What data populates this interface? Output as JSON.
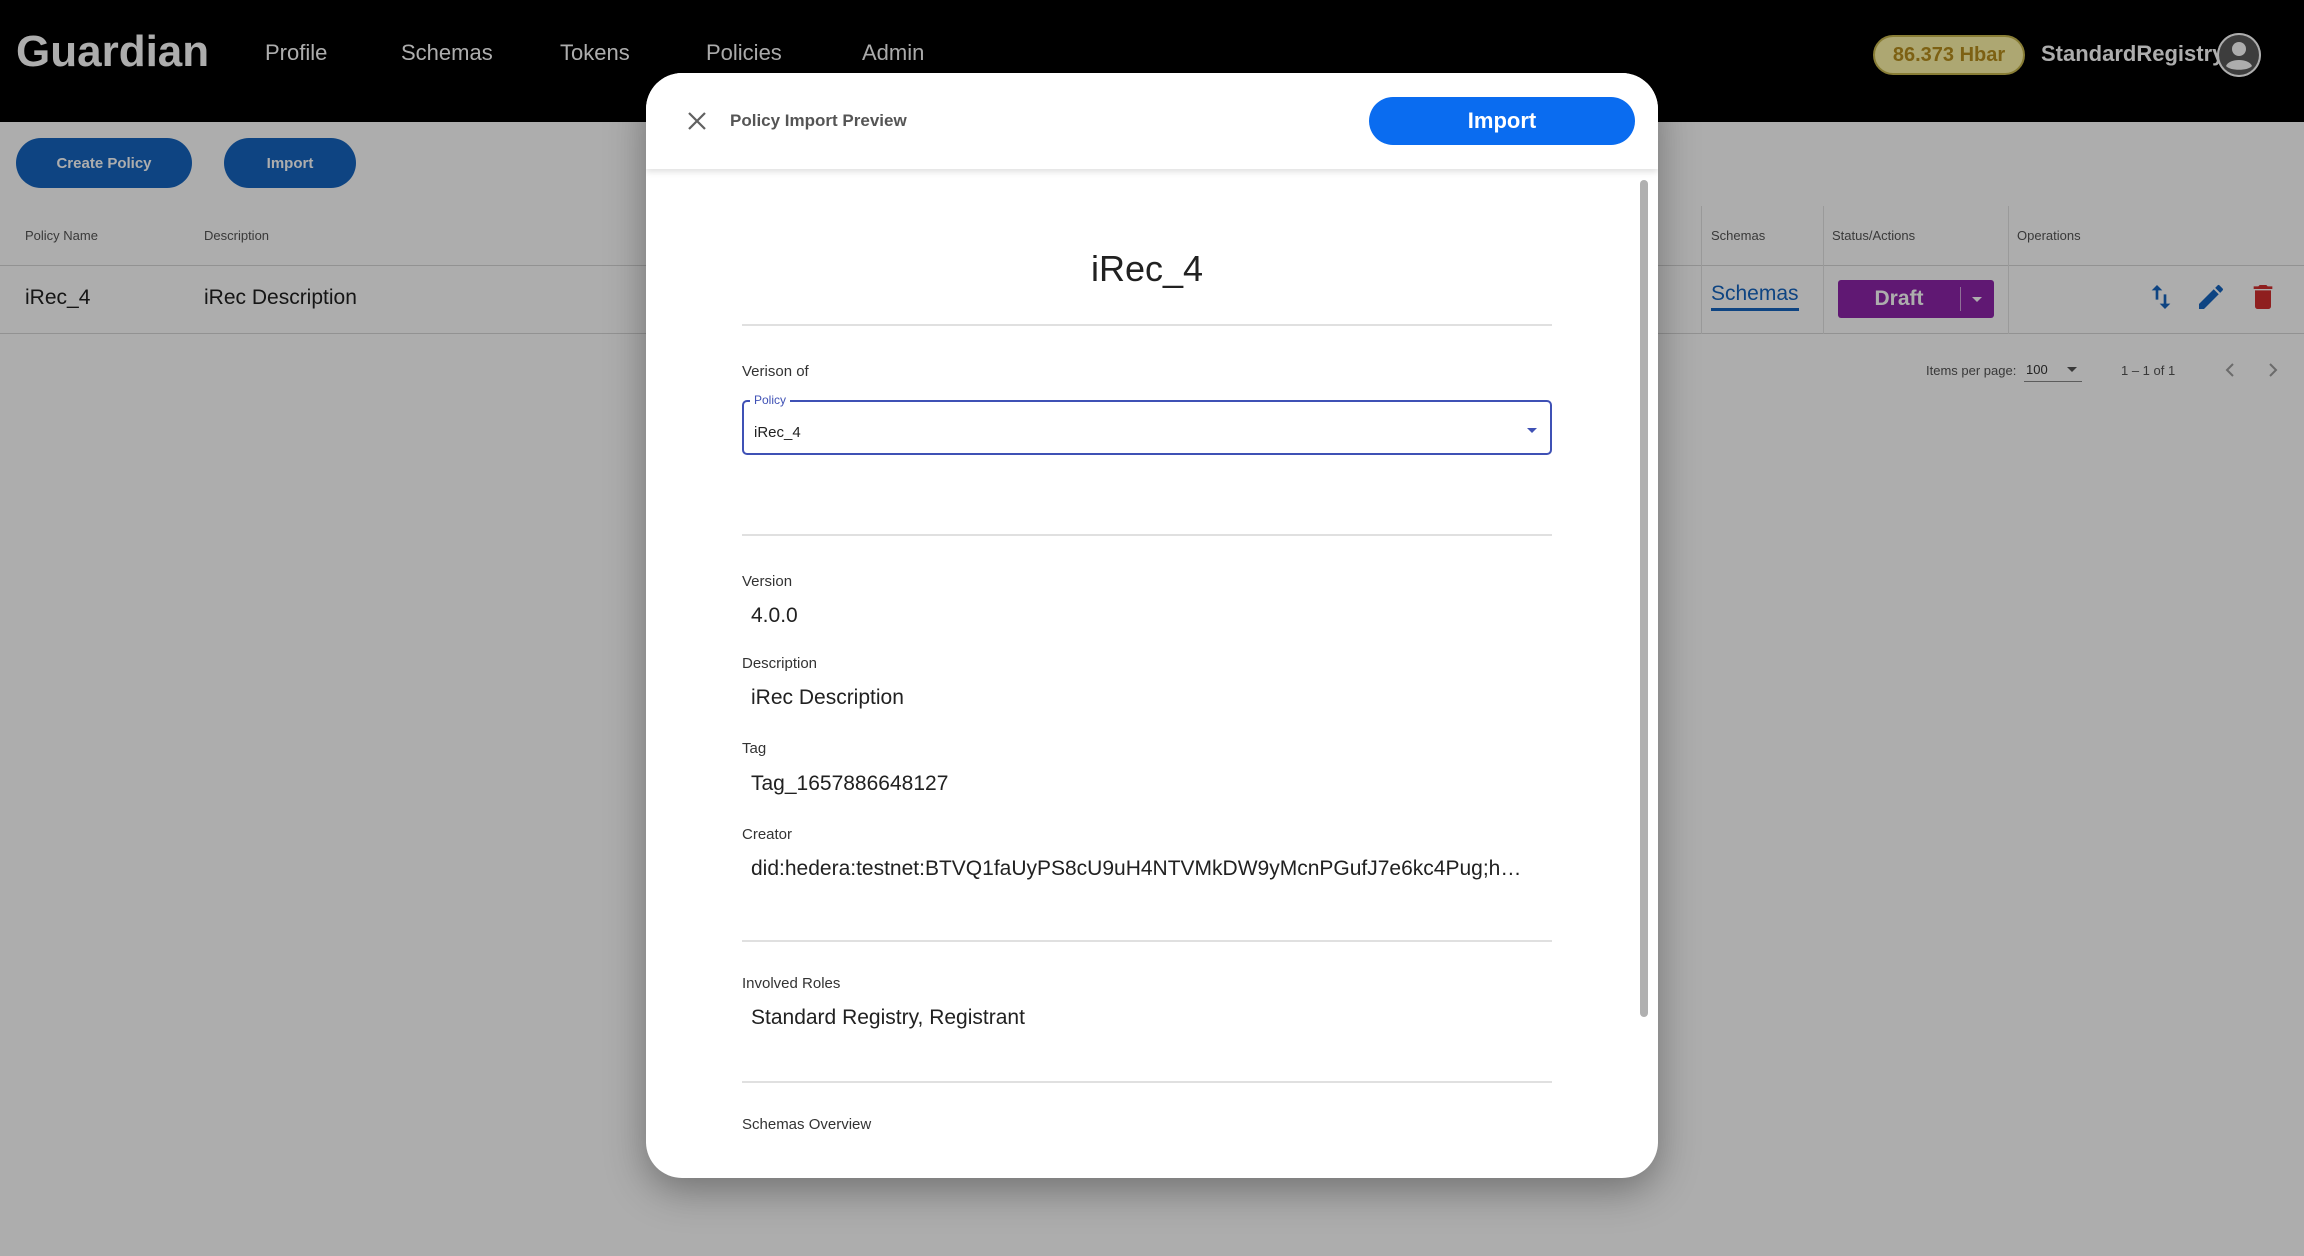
{
  "app": {
    "brand": "Guardian",
    "nav": [
      "Profile",
      "Schemas",
      "Tokens",
      "Policies",
      "Admin"
    ],
    "balance": "86.373 Hbar",
    "user": "StandardRegistry"
  },
  "toolbar": {
    "create_label": "Create Policy",
    "import_label": "Import"
  },
  "table": {
    "columns": {
      "name": "Policy Name",
      "description": "Description",
      "schemas": "Schemas",
      "status": "Status/Actions",
      "operations": "Operations"
    },
    "row": {
      "name": "iRec_4",
      "description": "iRec Description",
      "schemas_link": "Schemas",
      "status": "Draft"
    }
  },
  "pager": {
    "items_label": "Items per page:",
    "size": "100",
    "range": "1 – 1 of 1"
  },
  "dialog": {
    "title": "Policy Import Preview",
    "import_label": "Import",
    "policy_name": "iRec_4",
    "version_of_label": "Verison of",
    "select": {
      "legend": "Policy",
      "value": "iRec_4"
    },
    "version_label": "Version",
    "version": "4.0.0",
    "description_label": "Description",
    "description": "iRec Description",
    "tag_label": "Tag",
    "tag": "Tag_1657886648127",
    "creator_label": "Creator",
    "creator": "did:hedera:testnet:BTVQ1faUyPS8cU9uH4NTVMkDW9yMcnPGufJ7e6kc4Pug;h…",
    "roles_label": "Involved Roles",
    "roles": "Standard Registry, Registrant",
    "schemas_overview_label": "Schemas Overview"
  },
  "colors": {
    "primary": "#1565c0",
    "import": "#0a6cf0",
    "draft": "#8e24aa",
    "delete": "#d32f2f",
    "select_border": "#3f51b5",
    "balance_bg": "#fff6a8"
  },
  "icons": [
    "close-icon",
    "dropdown-arrow-icon",
    "swap-vert-icon",
    "edit-icon",
    "delete-icon",
    "account-circle-icon",
    "chevron-left-icon",
    "chevron-right-icon"
  ]
}
